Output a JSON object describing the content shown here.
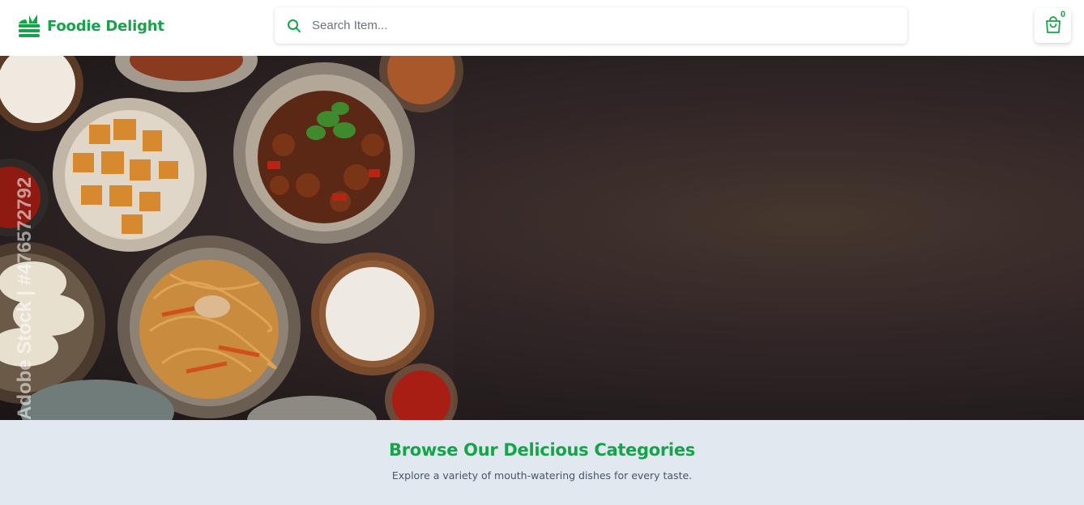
{
  "brand": {
    "name": "Foodie Delight",
    "icon": "burger-icon"
  },
  "search": {
    "placeholder": "Search Item...",
    "value": "",
    "icon": "search-icon"
  },
  "cart": {
    "count": "0",
    "icon": "shopping-bag-icon"
  },
  "hero": {
    "watermark": "Adobe Stock | #476572792"
  },
  "categories": {
    "title": "Browse Our Delicious Categories",
    "subtitle": "Explore a variety of mouth-watering dishes for every taste."
  },
  "colors": {
    "accent": "#16a34a",
    "section_bg": "#e2e8f0",
    "navbar_bg": "#ffffff"
  }
}
